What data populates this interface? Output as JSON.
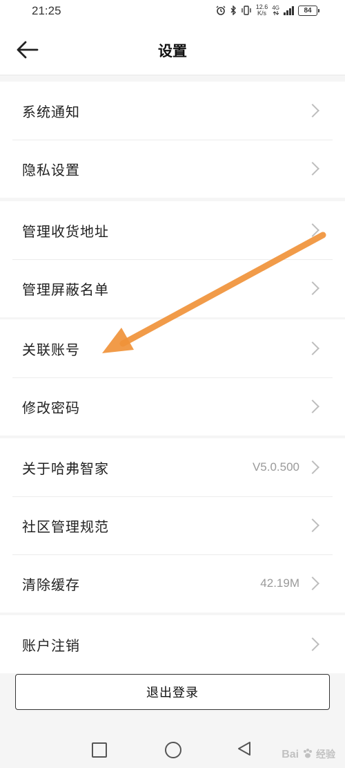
{
  "status_bar": {
    "time": "21:25",
    "speed_value": "12.6",
    "speed_unit": "K/s",
    "network_type": "4G",
    "battery": "84"
  },
  "header": {
    "title": "设置",
    "back_icon": "arrow-left-icon"
  },
  "groups": [
    {
      "items": [
        {
          "label": "系统通知",
          "value": ""
        },
        {
          "label": "隐私设置",
          "value": ""
        }
      ]
    },
    {
      "items": [
        {
          "label": "管理收货地址",
          "value": ""
        },
        {
          "label": "管理屏蔽名单",
          "value": ""
        }
      ]
    },
    {
      "items": [
        {
          "label": "关联账号",
          "value": ""
        },
        {
          "label": "修改密码",
          "value": ""
        }
      ]
    },
    {
      "items": [
        {
          "label": "关于哈弗智家",
          "value": "V5.0.500"
        },
        {
          "label": "社区管理规范",
          "value": ""
        },
        {
          "label": "清除缓存",
          "value": "42.19M"
        }
      ]
    },
    {
      "items": [
        {
          "label": "账户注销",
          "value": ""
        }
      ]
    }
  ],
  "logout_label": "退出登录",
  "nav_bar": {
    "recents_icon": "square-icon",
    "home_icon": "circle-icon",
    "back_icon": "triangle-back-icon"
  },
  "watermark": {
    "brand": "Bai",
    "suffix": "经验"
  },
  "colors": {
    "annotation_arrow": "#f0933a",
    "background": "#f5f5f5",
    "chevron": "#bdbdbd",
    "value_text": "#9a9a9a"
  }
}
